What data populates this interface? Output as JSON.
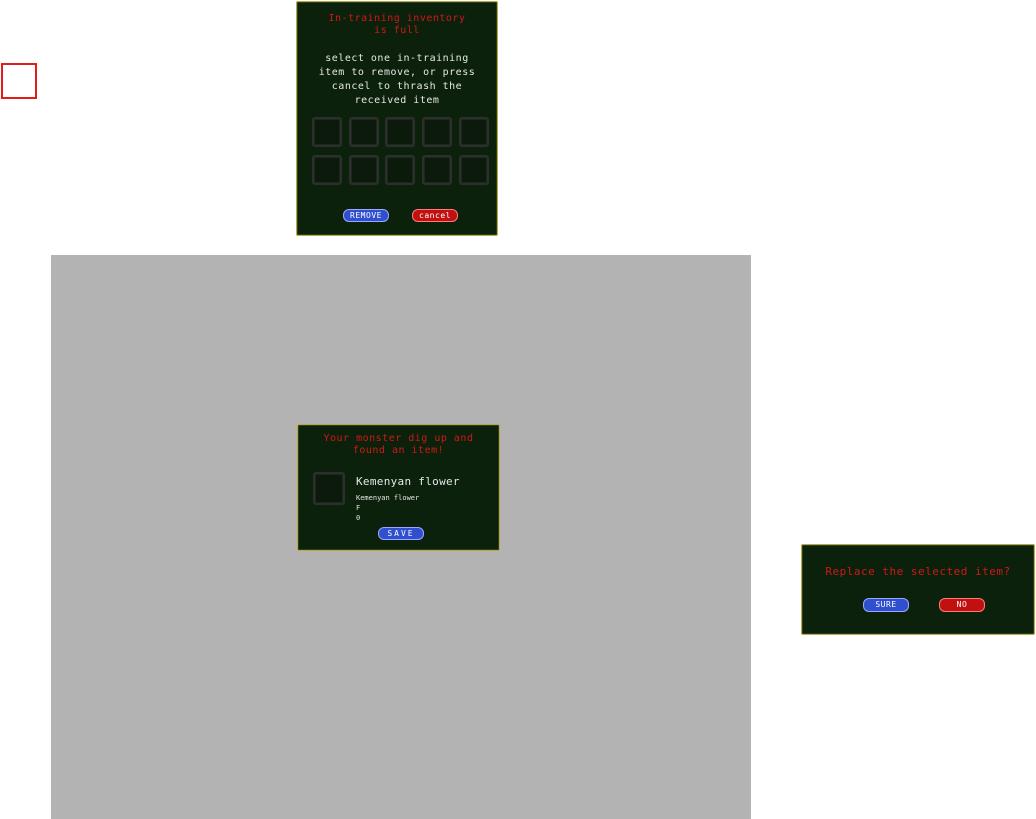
{
  "colors": {
    "panel_bg": "#0c210c",
    "panel_border": "#b8a848",
    "title_red": "#d01818",
    "button_blue": "#2f4fcf",
    "button_red": "#c01010",
    "backdrop_grey": "#b3b3b3",
    "marker_red": "#e01c1c"
  },
  "inventory_full_dialog": {
    "title_line1": "In-training inventory",
    "title_line2": "is full",
    "message_line1": "select one in-training",
    "message_line2": "item to remove, or press",
    "message_line3": "cancel to thrash the",
    "message_line4": "received item",
    "slot_count": 10,
    "remove_label": "REMOVE",
    "cancel_label": "cancel"
  },
  "found_item_dialog": {
    "title_line1": "Your monster dig up and",
    "title_line2": "found an item!",
    "item_name": "Kemenyan flower",
    "item_detail_name": "Kemenyan flower",
    "item_detail_line2": "F",
    "item_detail_line3": "0",
    "save_label": "SAVE"
  },
  "replace_dialog": {
    "question": "Replace the selected item?",
    "sure_label": "SURE",
    "no_label": "NO"
  }
}
